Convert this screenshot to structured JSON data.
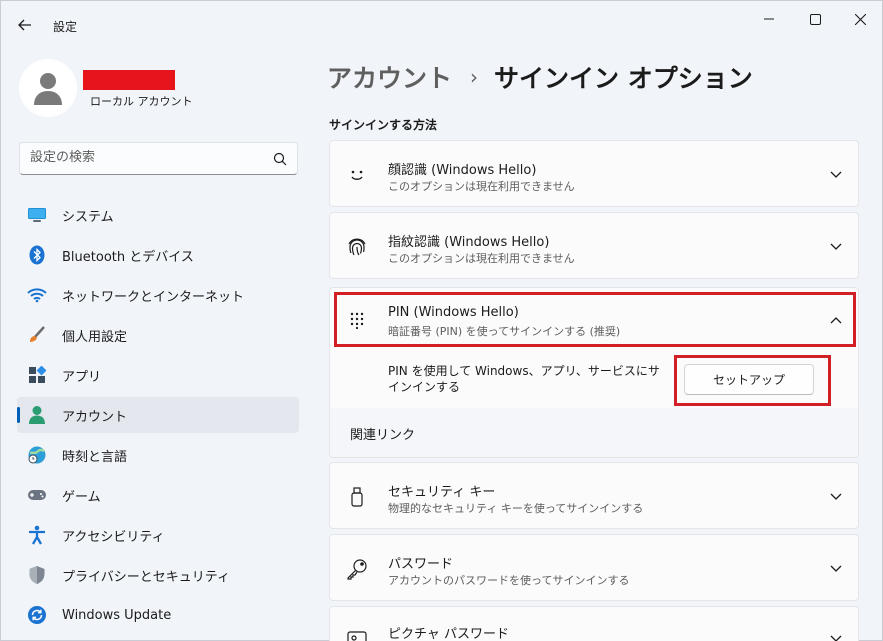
{
  "window": {
    "title": "設定",
    "controls": {
      "minimize": "minimize-icon",
      "maximize": "maximize-icon",
      "close": "close-icon"
    }
  },
  "profile": {
    "account_type": "ローカル アカウント"
  },
  "search": {
    "placeholder": "設定の検索"
  },
  "sidebar": {
    "items": [
      {
        "label": "システム",
        "icon": "system-icon"
      },
      {
        "label": "Bluetooth とデバイス",
        "icon": "bluetooth-icon"
      },
      {
        "label": "ネットワークとインターネット",
        "icon": "wifi-icon"
      },
      {
        "label": "個人用設定",
        "icon": "brush-icon"
      },
      {
        "label": "アプリ",
        "icon": "apps-icon"
      },
      {
        "label": "アカウント",
        "icon": "account-icon",
        "active": true
      },
      {
        "label": "時刻と言語",
        "icon": "time-language-icon"
      },
      {
        "label": "ゲーム",
        "icon": "gamepad-icon"
      },
      {
        "label": "アクセシビリティ",
        "icon": "accessibility-icon"
      },
      {
        "label": "プライバシーとセキュリティ",
        "icon": "shield-icon"
      },
      {
        "label": "Windows Update",
        "icon": "update-icon"
      }
    ]
  },
  "main": {
    "breadcrumb": {
      "parent": "アカウント",
      "separator": "›",
      "current": "サインイン オプション"
    },
    "section_title": "サインインする方法",
    "options": [
      {
        "title": "顔認識 (Windows Hello)",
        "subtitle": "このオプションは現在利用できません",
        "icon": "face-icon",
        "expanded": false
      },
      {
        "title": "指紋認識 (Windows Hello)",
        "subtitle": "このオプションは現在利用できません",
        "icon": "fingerprint-icon",
        "expanded": false
      },
      {
        "title": "PIN (Windows Hello)",
        "subtitle": "暗証番号 (PIN) を使ってサインインする (推奨)",
        "icon": "keypad-icon",
        "expanded": true
      }
    ],
    "pin_expanded": {
      "description": "PIN を使用して Windows、アプリ、サービスにサインインする",
      "button": "セットアップ",
      "related_links": "関連リンク"
    },
    "more_options": [
      {
        "title": "セキュリティ キー",
        "subtitle": "物理的なセキュリティ キーを使ってサインインする",
        "icon": "usb-key-icon"
      },
      {
        "title": "パスワード",
        "subtitle": "アカウントのパスワードを使ってサインインする",
        "icon": "key-icon"
      },
      {
        "title": "ピクチャ パスワード",
        "icon": "picture-password-icon"
      }
    ]
  },
  "colors": {
    "accent": "#005fb8",
    "highlight": "#d21f26",
    "redaction": "#e8141c"
  }
}
